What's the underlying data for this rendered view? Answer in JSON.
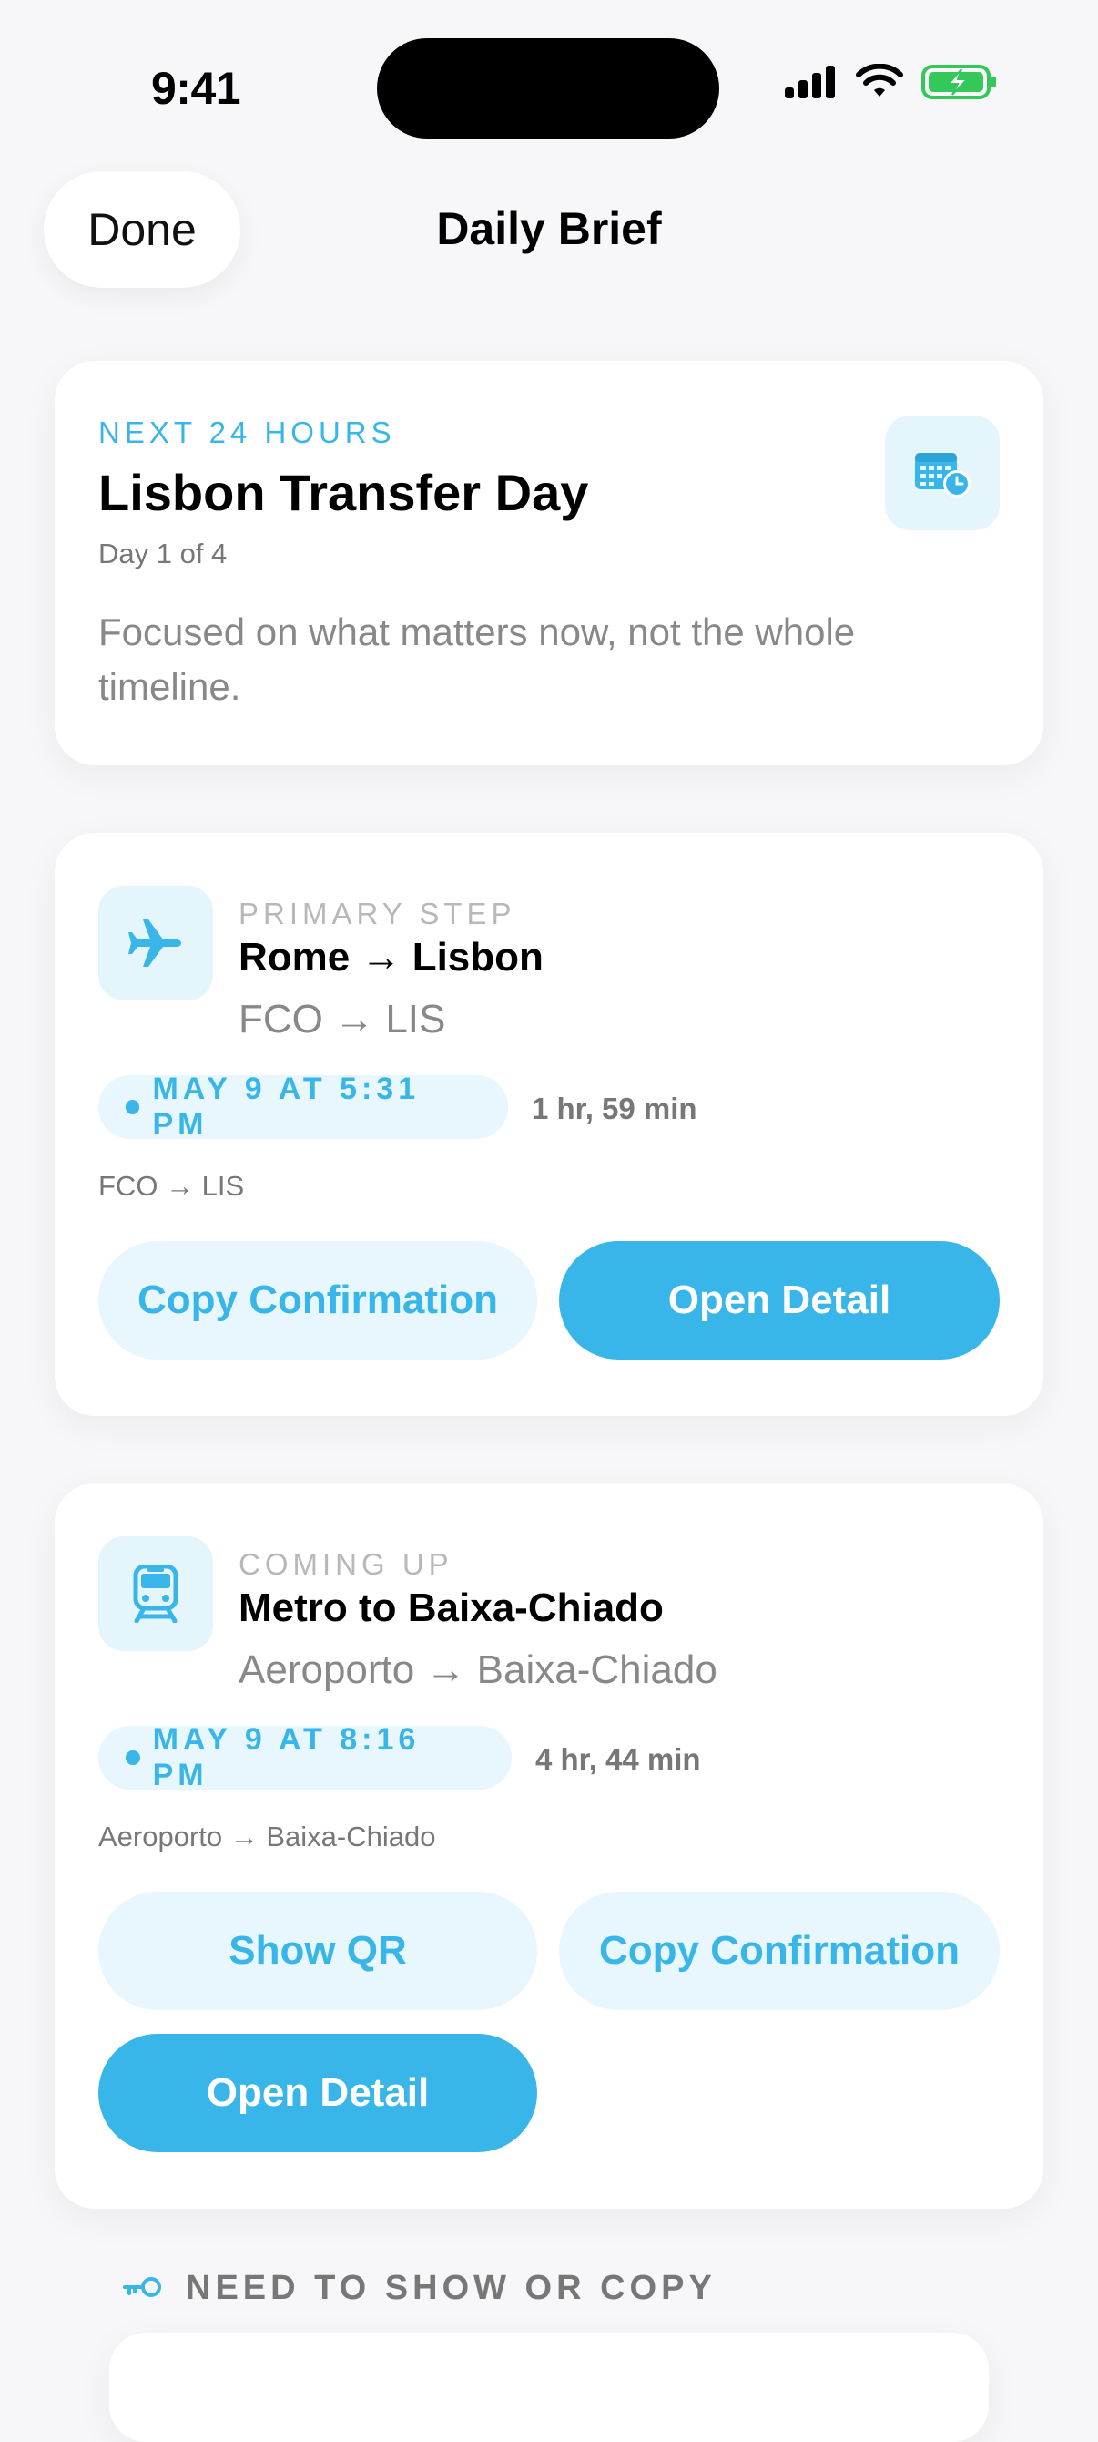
{
  "status_bar": {
    "time": "9:41"
  },
  "nav": {
    "done_label": "Done",
    "title": "Daily Brief"
  },
  "hero": {
    "eyebrow": "NEXT 24 HOURS",
    "title": "Lisbon Transfer Day",
    "subtitle": "Day 1 of 4",
    "description": "Focused on what matters now, not the whole timeline.",
    "icon": "calendar-clock-icon"
  },
  "steps": [
    {
      "eyebrow": "PRIMARY STEP",
      "title": "Rome → Lisbon",
      "route": "FCO → LIS",
      "icon": "airplane-icon",
      "time": "MAY 9 AT 5:31 PM",
      "duration": "1 hr, 59 min",
      "route_small": "FCO → LIS",
      "buttons": {
        "copy_confirmation": "Copy Confirmation",
        "open_detail": "Open Detail"
      }
    },
    {
      "eyebrow": "COMING UP",
      "title": "Metro to Baixa-Chiado",
      "route": "Aeroporto → Baixa-Chiado",
      "icon": "train-icon",
      "time": "MAY 9 AT 8:16 PM",
      "duration": "4 hr, 44 min",
      "route_small": "Aeroporto → Baixa-Chiado",
      "buttons": {
        "show_qr": "Show QR",
        "copy_confirmation": "Copy Confirmation",
        "open_detail": "Open Detail"
      }
    }
  ],
  "section": {
    "label": "NEED TO SHOW OR COPY",
    "icon": "key-icon"
  },
  "colors": {
    "accent": "#38b6ea",
    "accent_light": "#e8f6fd",
    "background": "#f7f7f9"
  }
}
